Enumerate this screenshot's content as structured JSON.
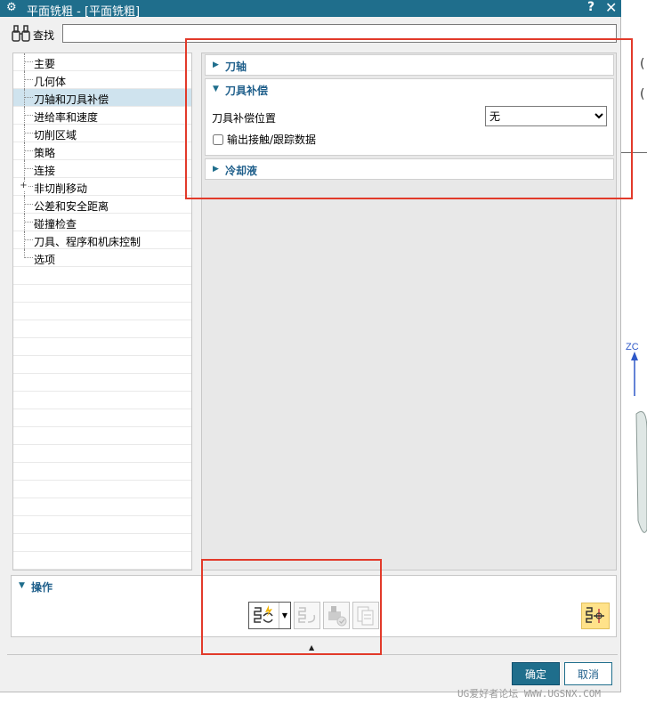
{
  "window": {
    "title": "平面铣粗 - [平面铣粗]",
    "help": "?",
    "close": "✕"
  },
  "find": {
    "label": "查找",
    "value": ""
  },
  "tree": {
    "items": [
      {
        "label": "主要",
        "selected": false,
        "expandable": false
      },
      {
        "label": "几何体",
        "selected": false,
        "expandable": false
      },
      {
        "label": "刀轴和刀具补偿",
        "selected": true,
        "expandable": false
      },
      {
        "label": "进给率和速度",
        "selected": false,
        "expandable": false
      },
      {
        "label": "切削区域",
        "selected": false,
        "expandable": false
      },
      {
        "label": "策略",
        "selected": false,
        "expandable": false
      },
      {
        "label": "连接",
        "selected": false,
        "expandable": false
      },
      {
        "label": "非切削移动",
        "selected": false,
        "expandable": true
      },
      {
        "label": "公差和安全距离",
        "selected": false,
        "expandable": false
      },
      {
        "label": "碰撞检查",
        "selected": false,
        "expandable": false
      },
      {
        "label": "刀具、程序和机床控制",
        "selected": false,
        "expandable": false
      },
      {
        "label": "选项",
        "selected": false,
        "expandable": false
      }
    ]
  },
  "panel": {
    "tool_axis": {
      "title": "刀轴",
      "expanded": false
    },
    "tool_comp": {
      "title": "刀具补偿",
      "expanded": true,
      "position_label": "刀具补偿位置",
      "position_value": "无",
      "output_label": "输出接触/跟踪数据",
      "output_checked": false
    },
    "coolant": {
      "title": "冷却液",
      "expanded": false
    }
  },
  "operations": {
    "title": "操作",
    "buttons": [
      "generate-icon",
      "replay-icon",
      "verify-icon",
      "list-icon",
      "display-resource-icon"
    ]
  },
  "footer": {
    "ok": "确定",
    "cancel": "取消"
  },
  "background": {
    "axis_label": "ZC",
    "paren1": "(",
    "paren2": "("
  },
  "watermark": "UG爱好者论坛 WWW.UGSNX.COM",
  "colors": {
    "title_bar": "#1f6e8c",
    "group_title": "#1f5f8b",
    "selection": "#cfe3ee",
    "highlight": "#ffe28a",
    "annotation": "#e23a2a"
  }
}
